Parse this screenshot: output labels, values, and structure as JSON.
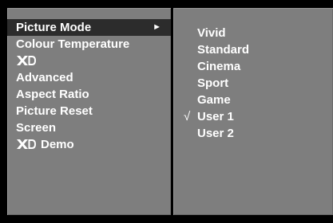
{
  "colors": {
    "background": "#000000",
    "panel": "#7e7e7e",
    "selected_row": "#2c2c2c",
    "text": "#ffffff"
  },
  "main_menu": {
    "items": [
      {
        "label": "Picture Mode",
        "selected": true,
        "submenu_arrow": "►"
      },
      {
        "label": "Colour Temperature"
      },
      {
        "label": "XD",
        "logo": true
      },
      {
        "label": "Advanced"
      },
      {
        "label": "Aspect Ratio"
      },
      {
        "label": "Picture Reset"
      },
      {
        "label": "Screen"
      },
      {
        "logo_text": "XD",
        "label": "Demo"
      }
    ]
  },
  "sub_menu": {
    "check_mark": "√",
    "items": [
      {
        "label": "Vivid"
      },
      {
        "label": "Standard"
      },
      {
        "label": "Cinema"
      },
      {
        "label": "Sport"
      },
      {
        "label": "Game"
      },
      {
        "label": "User 1",
        "checked": true
      },
      {
        "label": "User 2"
      }
    ]
  }
}
